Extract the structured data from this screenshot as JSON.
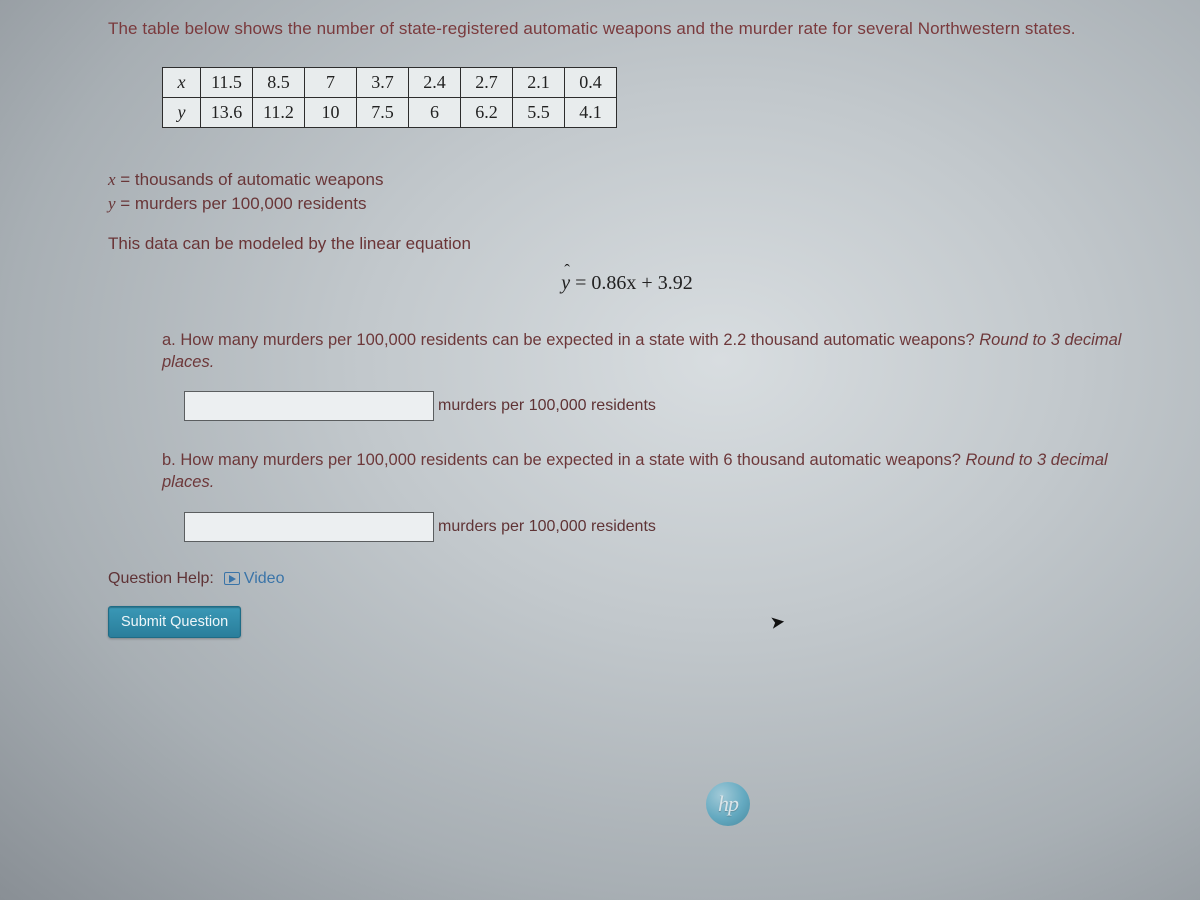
{
  "intro": "The table below shows the number of state-registered automatic weapons and the murder rate for several Northwestern states.",
  "table": {
    "row_x_label": "x",
    "row_y_label": "y",
    "x": [
      "11.5",
      "8.5",
      "7",
      "3.7",
      "2.4",
      "2.7",
      "2.1",
      "0.4"
    ],
    "y": [
      "13.6",
      "11.2",
      "10",
      "7.5",
      "6",
      "6.2",
      "5.5",
      "4.1"
    ]
  },
  "defs": {
    "line1_var": "x",
    "line1_rest": " = thousands of automatic weapons",
    "line2_var": "y",
    "line2_rest": " = murders per 100,000 residents"
  },
  "model_line": "This data can be modeled by the linear equation",
  "equation": {
    "lhs": "y",
    "rhs": " = 0.86x + 3.92"
  },
  "parts": {
    "a": {
      "label": "a. ",
      "text": "How many murders per 100,000 residents can be expected in a state with 2.2 thousand automatic weapons? ",
      "em": "Round to 3 decimal places.",
      "unit": "murders per 100,000 residents"
    },
    "b": {
      "label": "b. ",
      "text": "How many murders per 100,000 residents can be expected in a state with 6 thousand automatic weapons? ",
      "em": "Round to 3 decimal places.",
      "unit": "murders per 100,000 residents"
    }
  },
  "help": {
    "label": "Question Help:",
    "video": "Video"
  },
  "submit_label": "Submit Question",
  "logo_text": "hp",
  "chart_data": {
    "type": "table",
    "title": "State-registered automatic weapons vs murder rate (Northwestern states)",
    "xlabel": "thousands of automatic weapons",
    "ylabel": "murders per 100,000 residents",
    "series": [
      {
        "name": "x",
        "values": [
          11.5,
          8.5,
          7,
          3.7,
          2.4,
          2.7,
          2.1,
          0.4
        ]
      },
      {
        "name": "y",
        "values": [
          13.6,
          11.2,
          10,
          7.5,
          6,
          6.2,
          5.5,
          4.1
        ]
      }
    ],
    "model": "y_hat = 0.86x + 3.92"
  }
}
